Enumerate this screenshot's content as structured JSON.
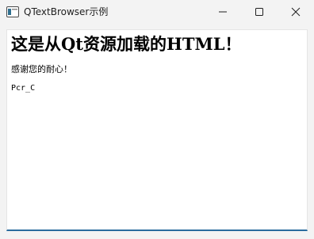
{
  "window": {
    "title": "QTextBrowser示例"
  },
  "browser": {
    "heading": "这是从Qt资源加载的HTML！",
    "paragraph": "感谢您的耐心！",
    "code_text": "Pcr_C"
  }
}
